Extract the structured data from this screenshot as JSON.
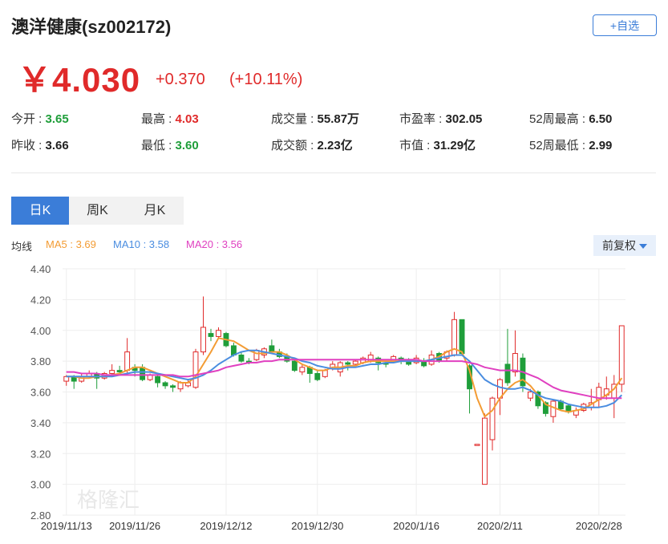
{
  "header": {
    "title": "澳洋健康(sz002172)",
    "add_favorite": "+自选",
    "price": "￥4.030",
    "change": "+0.370",
    "change_pct": "(+10.11%)"
  },
  "stats": [
    {
      "label": "今开 : ",
      "value": "3.65",
      "color": "green"
    },
    {
      "label": "最高 : ",
      "value": "4.03",
      "color": "red"
    },
    {
      "label": "成交量 : ",
      "value": "55.87万",
      "color": "dark"
    },
    {
      "label": "市盈率 : ",
      "value": "302.05",
      "color": "dark"
    },
    {
      "label": "52周最高 : ",
      "value": "6.50",
      "color": "dark"
    },
    {
      "label": "昨收 : ",
      "value": "3.66",
      "color": "dark"
    },
    {
      "label": "最低 : ",
      "value": "3.60",
      "color": "green"
    },
    {
      "label": "成交额 : ",
      "value": "2.23亿",
      "color": "dark"
    },
    {
      "label": "市值 : ",
      "value": "31.29亿",
      "color": "dark"
    },
    {
      "label": "52周最低 : ",
      "value": "2.99",
      "color": "dark"
    }
  ],
  "tabs": [
    {
      "label": "日K",
      "active": true
    },
    {
      "label": "周K",
      "active": false
    },
    {
      "label": "月K",
      "active": false
    }
  ],
  "ma_legend": {
    "prefix": "均线",
    "ma5": "MA5 : 3.69",
    "ma10": "MA10 : 3.58",
    "ma20": "MA20 : 3.56"
  },
  "adjust_button": "前复权",
  "watermark": "格隆汇",
  "colors": {
    "up": "#e02a2a",
    "down": "#1f9e3a",
    "ma5": "#f39c34",
    "ma10": "#4a8de0",
    "ma20": "#e040c0",
    "accent": "#3b7dd8"
  },
  "chart_data": {
    "type": "candlestick",
    "ylim": [
      2.8,
      4.4
    ],
    "y_ticks": [
      "4.40",
      "4.20",
      "4.00",
      "3.80",
      "3.60",
      "3.40",
      "3.20",
      "3.00",
      "2.80"
    ],
    "x_tick_labels": [
      {
        "label": "2019/11/13",
        "index": 0
      },
      {
        "label": "2019/11/26",
        "index": 9
      },
      {
        "label": "2019/12/12",
        "index": 21
      },
      {
        "label": "2019/12/30",
        "index": 33
      },
      {
        "label": "2020/1/16",
        "index": 46
      },
      {
        "label": "2020/2/11",
        "index": 57
      },
      {
        "label": "2020/2/28",
        "index": 70
      }
    ],
    "candles": [
      {
        "o": 3.67,
        "c": 3.7,
        "h": 3.71,
        "l": 3.64
      },
      {
        "o": 3.7,
        "c": 3.67,
        "h": 3.71,
        "l": 3.62
      },
      {
        "o": 3.67,
        "c": 3.7,
        "h": 3.72,
        "l": 3.66
      },
      {
        "o": 3.7,
        "c": 3.72,
        "h": 3.74,
        "l": 3.69
      },
      {
        "o": 3.72,
        "c": 3.69,
        "h": 3.73,
        "l": 3.62
      },
      {
        "o": 3.69,
        "c": 3.72,
        "h": 3.73,
        "l": 3.68
      },
      {
        "o": 3.72,
        "c": 3.74,
        "h": 3.78,
        "l": 3.7
      },
      {
        "o": 3.74,
        "c": 3.73,
        "h": 3.77,
        "l": 3.72
      },
      {
        "o": 3.74,
        "c": 3.86,
        "h": 3.95,
        "l": 3.72
      },
      {
        "o": 3.76,
        "c": 3.74,
        "h": 3.78,
        "l": 3.7
      },
      {
        "o": 3.76,
        "c": 3.68,
        "h": 3.78,
        "l": 3.67
      },
      {
        "o": 3.68,
        "c": 3.71,
        "h": 3.72,
        "l": 3.67
      },
      {
        "o": 3.7,
        "c": 3.66,
        "h": 3.71,
        "l": 3.63
      },
      {
        "o": 3.66,
        "c": 3.64,
        "h": 3.67,
        "l": 3.62
      },
      {
        "o": 3.64,
        "c": 3.63,
        "h": 3.65,
        "l": 3.6
      },
      {
        "o": 3.62,
        "c": 3.66,
        "h": 3.67,
        "l": 3.6
      },
      {
        "o": 3.64,
        "c": 3.66,
        "h": 3.68,
        "l": 3.63
      },
      {
        "o": 3.63,
        "c": 3.86,
        "h": 3.88,
        "l": 3.62
      },
      {
        "o": 3.86,
        "c": 4.02,
        "h": 4.22,
        "l": 3.84
      },
      {
        "o": 3.98,
        "c": 3.96,
        "h": 4.01,
        "l": 3.93
      },
      {
        "o": 3.96,
        "c": 4.0,
        "h": 4.02,
        "l": 3.95
      },
      {
        "o": 3.98,
        "c": 3.9,
        "h": 3.99,
        "l": 3.89
      },
      {
        "o": 3.9,
        "c": 3.84,
        "h": 3.92,
        "l": 3.83
      },
      {
        "o": 3.84,
        "c": 3.8,
        "h": 3.86,
        "l": 3.79
      },
      {
        "o": 3.8,
        "c": 3.79,
        "h": 3.82,
        "l": 3.78
      },
      {
        "o": 3.81,
        "c": 3.87,
        "h": 3.88,
        "l": 3.8
      },
      {
        "o": 3.84,
        "c": 3.88,
        "h": 3.89,
        "l": 3.82
      },
      {
        "o": 3.9,
        "c": 3.86,
        "h": 3.94,
        "l": 3.85
      },
      {
        "o": 3.86,
        "c": 3.83,
        "h": 3.88,
        "l": 3.82
      },
      {
        "o": 3.83,
        "c": 3.8,
        "h": 3.85,
        "l": 3.79
      },
      {
        "o": 3.8,
        "c": 3.74,
        "h": 3.82,
        "l": 3.73
      },
      {
        "o": 3.73,
        "c": 3.76,
        "h": 3.78,
        "l": 3.71
      },
      {
        "o": 3.76,
        "c": 3.72,
        "h": 3.77,
        "l": 3.66
      },
      {
        "o": 3.72,
        "c": 3.68,
        "h": 3.74,
        "l": 3.67
      },
      {
        "o": 3.7,
        "c": 3.74,
        "h": 3.75,
        "l": 3.69
      },
      {
        "o": 3.75,
        "c": 3.78,
        "h": 3.8,
        "l": 3.74
      },
      {
        "o": 3.73,
        "c": 3.79,
        "h": 3.8,
        "l": 3.7
      },
      {
        "o": 3.79,
        "c": 3.78,
        "h": 3.8,
        "l": 3.74
      },
      {
        "o": 3.78,
        "c": 3.8,
        "h": 3.81,
        "l": 3.77
      },
      {
        "o": 3.79,
        "c": 3.82,
        "h": 3.83,
        "l": 3.78
      },
      {
        "o": 3.8,
        "c": 3.84,
        "h": 3.86,
        "l": 3.79
      },
      {
        "o": 3.82,
        "c": 3.79,
        "h": 3.83,
        "l": 3.74
      },
      {
        "o": 3.79,
        "c": 3.78,
        "h": 3.8,
        "l": 3.76
      },
      {
        "o": 3.8,
        "c": 3.83,
        "h": 3.84,
        "l": 3.79
      },
      {
        "o": 3.82,
        "c": 3.8,
        "h": 3.83,
        "l": 3.78
      },
      {
        "o": 3.8,
        "c": 3.78,
        "h": 3.82,
        "l": 3.77
      },
      {
        "o": 3.79,
        "c": 3.82,
        "h": 3.84,
        "l": 3.78
      },
      {
        "o": 3.8,
        "c": 3.77,
        "h": 3.82,
        "l": 3.76
      },
      {
        "o": 3.78,
        "c": 3.84,
        "h": 3.87,
        "l": 3.77
      },
      {
        "o": 3.85,
        "c": 3.8,
        "h": 3.86,
        "l": 3.79
      },
      {
        "o": 3.82,
        "c": 3.86,
        "h": 3.87,
        "l": 3.8
      },
      {
        "o": 3.84,
        "c": 4.07,
        "h": 4.12,
        "l": 3.83
      },
      {
        "o": 4.07,
        "c": 3.85,
        "h": 4.07,
        "l": 3.84
      },
      {
        "o": 3.77,
        "c": 3.62,
        "h": 3.78,
        "l": 3.46
      },
      {
        "o": 3.26,
        "c": 3.26,
        "h": 3.26,
        "l": 3.26
      },
      {
        "o": 3.0,
        "c": 3.43,
        "h": 3.46,
        "l": 3.0
      },
      {
        "o": 3.29,
        "c": 3.56,
        "h": 3.57,
        "l": 3.22
      },
      {
        "o": 3.56,
        "c": 3.68,
        "h": 3.69,
        "l": 3.45
      },
      {
        "o": 3.78,
        "c": 3.66,
        "h": 4.01,
        "l": 3.64
      },
      {
        "o": 3.73,
        "c": 3.85,
        "h": 4.0,
        "l": 3.7
      },
      {
        "o": 3.82,
        "c": 3.64,
        "h": 3.85,
        "l": 3.6
      },
      {
        "o": 3.56,
        "c": 3.6,
        "h": 3.62,
        "l": 3.54
      },
      {
        "o": 3.6,
        "c": 3.51,
        "h": 3.61,
        "l": 3.49
      },
      {
        "o": 3.53,
        "c": 3.46,
        "h": 3.54,
        "l": 3.44
      },
      {
        "o": 3.44,
        "c": 3.54,
        "h": 3.55,
        "l": 3.4
      },
      {
        "o": 3.54,
        "c": 3.49,
        "h": 3.55,
        "l": 3.48
      },
      {
        "o": 3.51,
        "c": 3.47,
        "h": 3.52,
        "l": 3.46
      },
      {
        "o": 3.45,
        "c": 3.48,
        "h": 3.5,
        "l": 3.43
      },
      {
        "o": 3.48,
        "c": 3.52,
        "h": 3.53,
        "l": 3.47
      },
      {
        "o": 3.5,
        "c": 3.53,
        "h": 3.62,
        "l": 3.48
      },
      {
        "o": 3.55,
        "c": 3.63,
        "h": 3.66,
        "l": 3.5
      },
      {
        "o": 3.58,
        "c": 3.62,
        "h": 3.7,
        "l": 3.55
      },
      {
        "o": 3.56,
        "c": 3.65,
        "h": 3.71,
        "l": 3.43
      },
      {
        "o": 3.65,
        "c": 4.03,
        "h": 4.03,
        "l": 3.6
      }
    ],
    "series": [
      {
        "name": "MA5",
        "values": [
          3.7,
          3.7,
          3.69,
          3.69,
          3.7,
          3.7,
          3.71,
          3.72,
          3.74,
          3.76,
          3.76,
          3.74,
          3.72,
          3.7,
          3.68,
          3.66,
          3.66,
          3.7,
          3.78,
          3.86,
          3.95,
          3.94,
          3.93,
          3.9,
          3.87,
          3.85,
          3.85,
          3.86,
          3.86,
          3.84,
          3.81,
          3.78,
          3.76,
          3.74,
          3.74,
          3.76,
          3.76,
          3.77,
          3.77,
          3.79,
          3.8,
          3.8,
          3.8,
          3.8,
          3.8,
          3.8,
          3.8,
          3.8,
          3.81,
          3.83,
          3.86,
          3.88,
          3.86,
          3.74,
          3.56,
          3.44,
          3.48,
          3.56,
          3.62,
          3.66,
          3.68,
          3.64,
          3.58,
          3.52,
          3.5,
          3.48,
          3.47,
          3.48,
          3.49,
          3.52,
          3.55,
          3.58,
          3.62,
          3.69
        ]
      },
      {
        "name": "MA10",
        "values": [
          3.7,
          3.7,
          3.7,
          3.7,
          3.7,
          3.7,
          3.7,
          3.71,
          3.72,
          3.73,
          3.73,
          3.73,
          3.72,
          3.71,
          3.7,
          3.69,
          3.68,
          3.69,
          3.71,
          3.74,
          3.78,
          3.81,
          3.84,
          3.86,
          3.87,
          3.87,
          3.86,
          3.85,
          3.84,
          3.83,
          3.82,
          3.8,
          3.79,
          3.77,
          3.76,
          3.75,
          3.75,
          3.76,
          3.76,
          3.77,
          3.78,
          3.78,
          3.79,
          3.79,
          3.8,
          3.8,
          3.8,
          3.8,
          3.81,
          3.82,
          3.83,
          3.84,
          3.84,
          3.8,
          3.74,
          3.68,
          3.65,
          3.63,
          3.62,
          3.62,
          3.63,
          3.61,
          3.58,
          3.56,
          3.55,
          3.54,
          3.52,
          3.51,
          3.5,
          3.5,
          3.5,
          3.51,
          3.53,
          3.58
        ]
      },
      {
        "name": "MA20",
        "values": [
          3.73,
          3.73,
          3.72,
          3.72,
          3.72,
          3.71,
          3.71,
          3.71,
          3.71,
          3.71,
          3.71,
          3.71,
          3.71,
          3.71,
          3.71,
          3.7,
          3.7,
          3.71,
          3.72,
          3.73,
          3.74,
          3.76,
          3.77,
          3.78,
          3.79,
          3.79,
          3.8,
          3.8,
          3.81,
          3.81,
          3.81,
          3.81,
          3.81,
          3.81,
          3.81,
          3.81,
          3.81,
          3.81,
          3.81,
          3.81,
          3.81,
          3.81,
          3.81,
          3.81,
          3.81,
          3.81,
          3.81,
          3.8,
          3.8,
          3.8,
          3.8,
          3.8,
          3.8,
          3.79,
          3.78,
          3.76,
          3.75,
          3.74,
          3.74,
          3.74,
          3.73,
          3.71,
          3.69,
          3.66,
          3.63,
          3.61,
          3.6,
          3.59,
          3.58,
          3.57,
          3.56,
          3.56,
          3.56,
          3.56
        ]
      }
    ],
    "grid": true
  }
}
